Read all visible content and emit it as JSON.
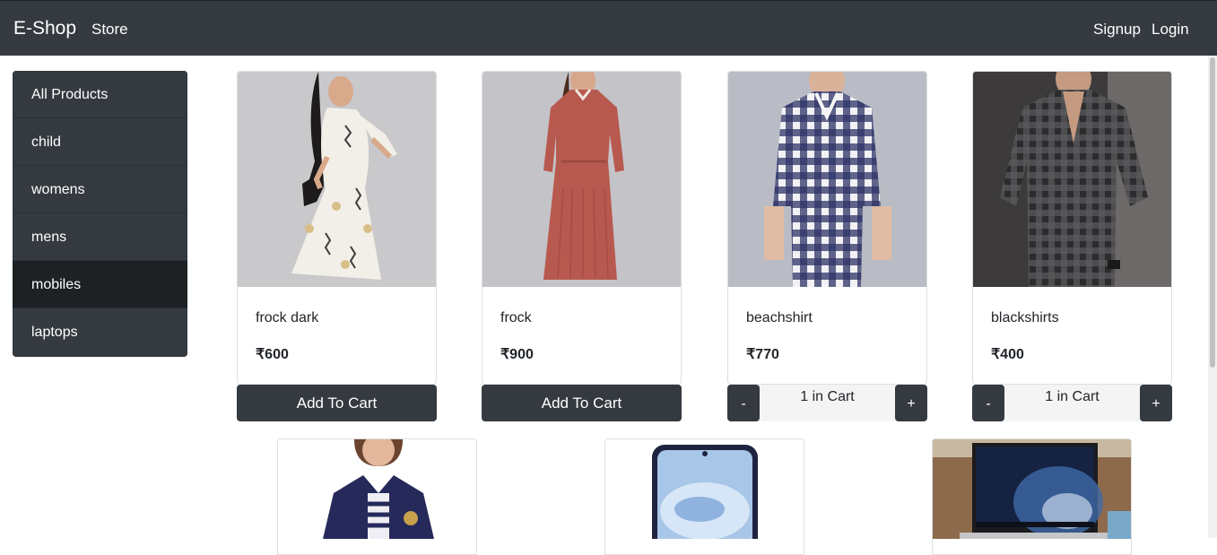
{
  "navbar": {
    "brand": "E-Shop",
    "store": "Store",
    "signup": "Signup",
    "login": "Login"
  },
  "sidebar": {
    "items": [
      {
        "label": "All Products"
      },
      {
        "label": "child"
      },
      {
        "label": "womens"
      },
      {
        "label": "mens"
      },
      {
        "label": "mobiles"
      },
      {
        "label": "laptops"
      }
    ]
  },
  "products": [
    {
      "title": "frock dark",
      "price": "₹600",
      "button": "Add To Cart"
    },
    {
      "title": "frock",
      "price": "₹900",
      "button": "Add To Cart"
    },
    {
      "title": "beachshirt",
      "price": "₹770",
      "qty_text": "1 in Cart",
      "minus": "-",
      "plus": "+"
    },
    {
      "title": "blackshirts",
      "price": "₹400",
      "qty_text": "1 in Cart",
      "minus": "-",
      "plus": "+"
    }
  ],
  "colors": {
    "navbar": "#343a40",
    "active_item": "#1d2124",
    "button": "#343a40"
  }
}
